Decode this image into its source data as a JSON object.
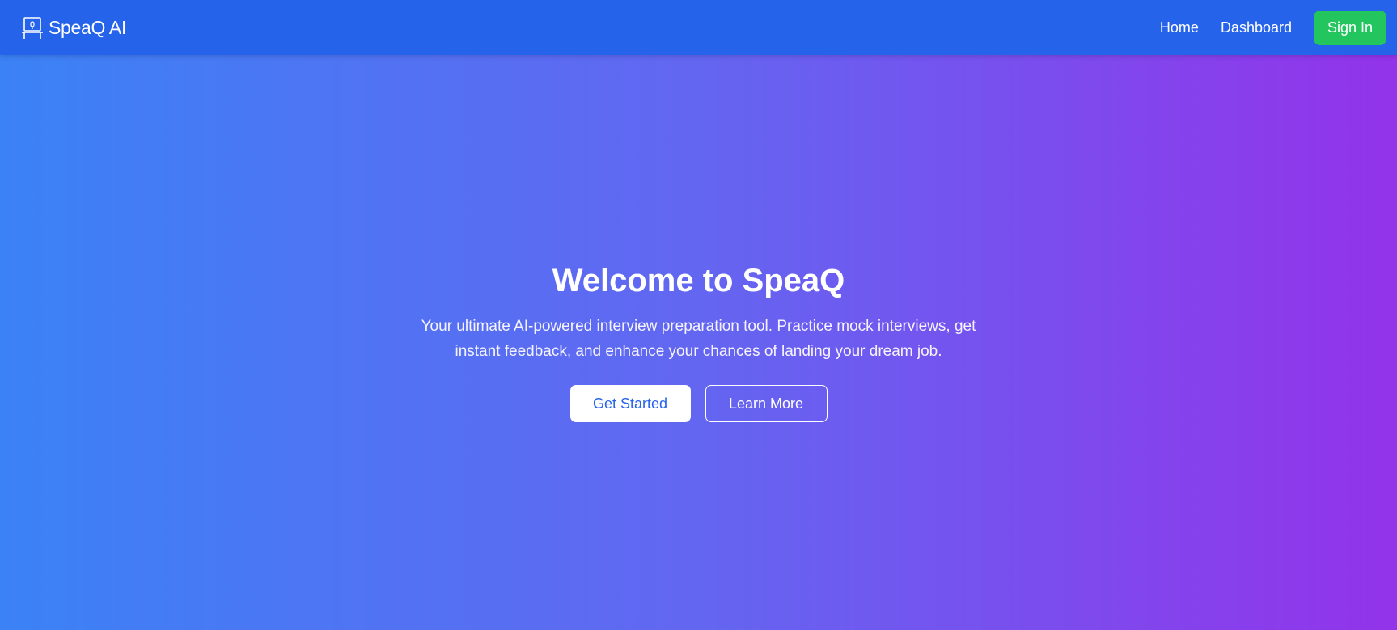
{
  "navbar": {
    "brand_icon": "podium-icon",
    "brand_text": "SpeaQ AI",
    "links": [
      {
        "label": "Home"
      },
      {
        "label": "Dashboard"
      }
    ],
    "signin_label": "Sign In"
  },
  "hero": {
    "title": "Welcome to SpeaQ",
    "subtitle": "Your ultimate AI-powered interview preparation tool. Practice mock interviews, get instant feedback, and enhance your chances of landing your dream job.",
    "primary_label": "Get Started",
    "secondary_label": "Learn More"
  },
  "colors": {
    "navbar_bg": "#2563eb",
    "gradient_start": "#3b82f6",
    "gradient_mid": "#6366f1",
    "gradient_end": "#9333ea",
    "signin_bg": "#22c55e",
    "primary_text": "#2563eb"
  }
}
